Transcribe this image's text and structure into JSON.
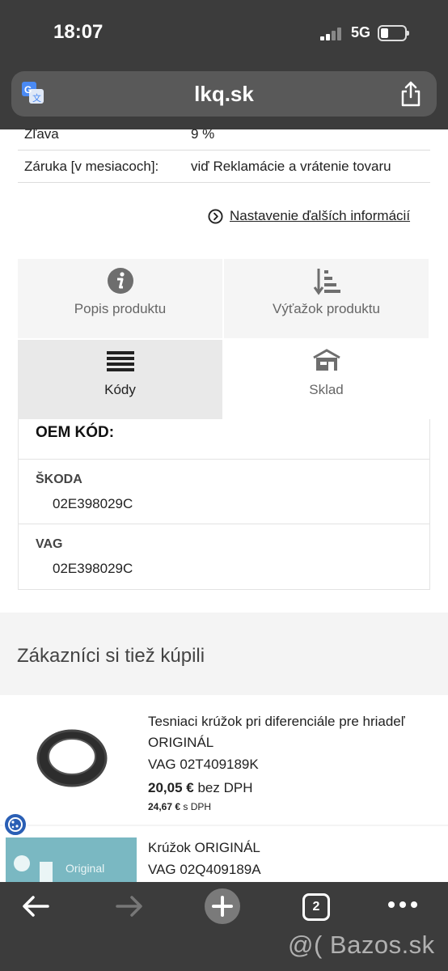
{
  "status_bar": {
    "time": "18:07",
    "network": "5G"
  },
  "browser": {
    "url": "lkq.sk",
    "tab_count": "2"
  },
  "spec_rows": [
    {
      "key": "Zľava",
      "value": "9 %"
    },
    {
      "key": "Záruka [v mesiacoch]:",
      "value": "viď Reklamácie a vrátenie tovaru"
    }
  ],
  "more_info_link": "Nastavenie ďalších informácií",
  "tabs": [
    {
      "label": "Popis produktu",
      "icon": "info-icon"
    },
    {
      "label": "Výťažok produktu",
      "icon": "sort-icon"
    },
    {
      "label": "Kódy",
      "icon": "list-icon",
      "active": true
    },
    {
      "label": "Sklad",
      "icon": "warehouse-icon"
    }
  ],
  "oem": {
    "heading": "OEM KÓD:",
    "entries": [
      {
        "brand": "ŠKODA",
        "code": "02E398029C"
      },
      {
        "brand": "VAG",
        "code": "02E398029C"
      }
    ]
  },
  "also_bought": {
    "title": "Zákazníci si tiež kúpili",
    "products": [
      {
        "name": "Tesniaci krúžok pri diferenciále pre hriadeľ ORIGINÁL",
        "code": "VAG 02T409189K",
        "price_net": "20,05 €",
        "price_net_suffix": " bez DPH",
        "price_gross": "24,67 €",
        "price_gross_suffix": " s DPH"
      },
      {
        "name": "Krúžok ORIGINÁL",
        "code": "VAG 02Q409189A",
        "thumb_text": "Original"
      }
    ]
  },
  "watermark": "@( Bazos.sk",
  "colors": {
    "chrome": "#3c3c3c",
    "urlbar": "#595959",
    "cookie": "#2a5fb5"
  }
}
